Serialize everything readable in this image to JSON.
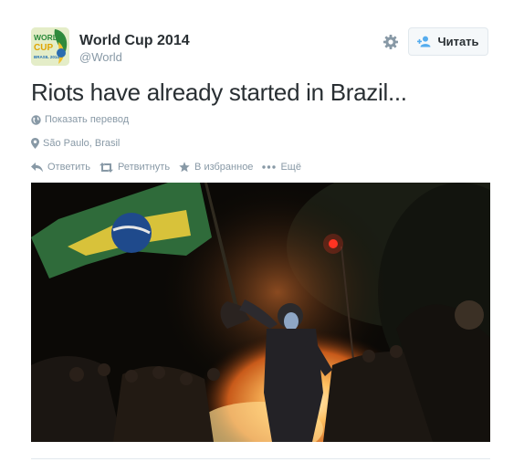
{
  "user": {
    "display_name": "World Cup 2014",
    "handle": "@World",
    "avatar_text": [
      "WORLD",
      "CUP",
      "BRASIL 2014"
    ]
  },
  "follow_button": {
    "label": "Читать",
    "icon": "add-user-icon"
  },
  "settings": {
    "icon": "gear-icon"
  },
  "tweet": {
    "text": "Riots have already started in Brazil..."
  },
  "translate": {
    "icon": "globe-icon",
    "label": "Показать перевод"
  },
  "location": {
    "icon": "map-pin-icon",
    "label": "São Paulo, Brasil"
  },
  "actions": {
    "reply": {
      "icon": "reply-icon",
      "label": "Ответить"
    },
    "retweet": {
      "icon": "retweet-icon",
      "label": "Ретвитнуть"
    },
    "favorite": {
      "icon": "star-icon",
      "label": "В избранное"
    },
    "more": {
      "icon": "more-dots-icon",
      "label": "Ещё"
    }
  },
  "colors": {
    "text": "#292f33",
    "muted": "#8899a6",
    "accent": "#55acee",
    "border": "#e1e8ed"
  }
}
